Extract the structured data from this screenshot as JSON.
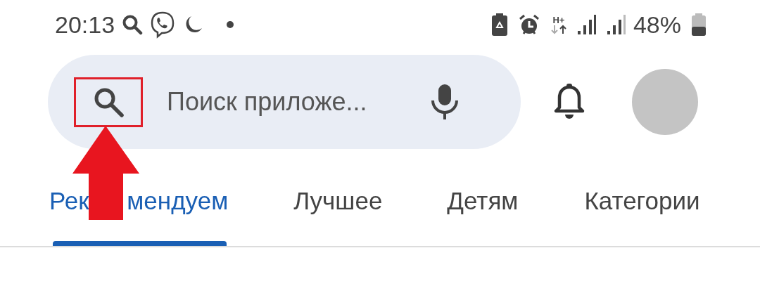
{
  "status_bar": {
    "time": "20:13",
    "network_type": "H+",
    "battery_percent": "48%"
  },
  "search": {
    "placeholder": "Поиск приложе..."
  },
  "tabs": [
    {
      "label": "Рек мендуем",
      "selected": true
    },
    {
      "label": "Лучшее",
      "selected": false
    },
    {
      "label": "Детям",
      "selected": false
    },
    {
      "label": "Категории",
      "selected": false
    }
  ],
  "annotation": {
    "kind": "arrow"
  }
}
